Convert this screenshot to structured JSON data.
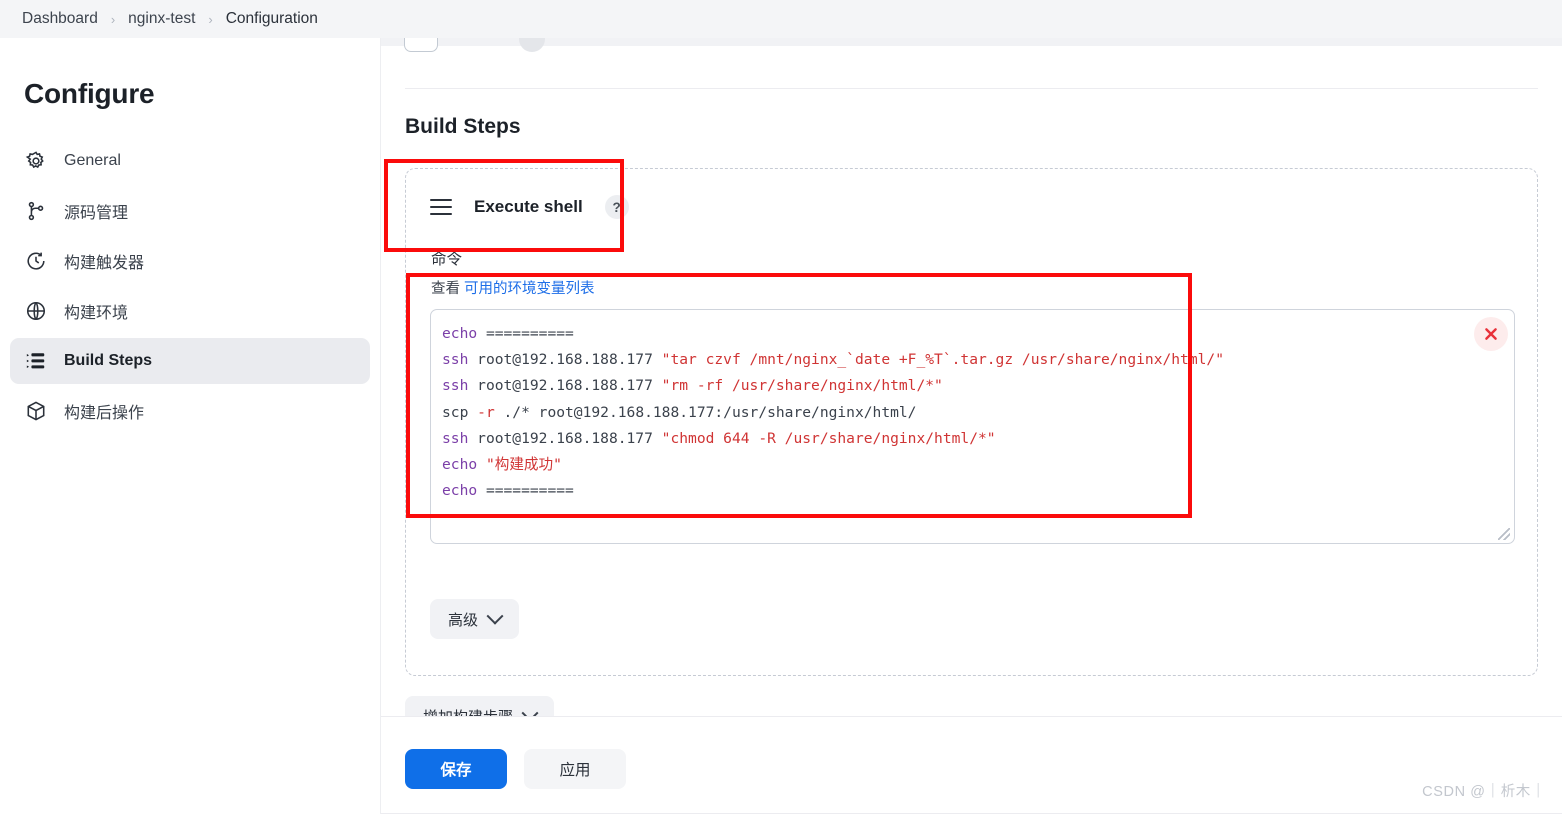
{
  "breadcrumb": {
    "items": [
      "Dashboard",
      "nginx-test",
      "Configuration"
    ],
    "separator": "›"
  },
  "sidebar": {
    "title": "Configure",
    "items": [
      {
        "label": "General",
        "icon": "gear-icon",
        "active": false
      },
      {
        "label": "源码管理",
        "icon": "source-branch-icon",
        "active": false
      },
      {
        "label": "构建触发器",
        "icon": "clock-icon",
        "active": false
      },
      {
        "label": "构建环境",
        "icon": "globe-icon",
        "active": false
      },
      {
        "label": "Build Steps",
        "icon": "list-icon",
        "active": true
      },
      {
        "label": "构建后操作",
        "icon": "package-icon",
        "active": false
      }
    ]
  },
  "main": {
    "section_title": "Build Steps",
    "step": {
      "drag_handle_icon": "hamburger-drag-icon",
      "name": "Execute shell",
      "help_label": "?",
      "delete_icon": "close-icon",
      "field_label": "命令",
      "hint_prefix": "查看 ",
      "hint_link": "可用的环境变量列表",
      "advanced_label": "高级",
      "chevron_icon": "chevron-down-icon"
    },
    "add_step_label": "增加构建步骤",
    "code_lines": [
      [
        {
          "t": "echo ",
          "c": "kw"
        },
        {
          "t": "==========",
          "c": "plain"
        }
      ],
      [
        {
          "t": "ssh ",
          "c": "kw"
        },
        {
          "t": "root@192.168.188.177 ",
          "c": "plain"
        },
        {
          "t": "\"tar czvf /mnt/nginx_`date +F_%T`.tar.gz /usr/share/nginx/html/\"",
          "c": "str"
        }
      ],
      [
        {
          "t": "ssh ",
          "c": "kw"
        },
        {
          "t": "root@192.168.188.177 ",
          "c": "plain"
        },
        {
          "t": "\"rm -rf /usr/share/nginx/html/*\"",
          "c": "str"
        }
      ],
      [
        {
          "t": "scp ",
          "c": "plain"
        },
        {
          "t": "-r",
          "c": "flag"
        },
        {
          "t": " ./* root@192.168.188.177:/usr/share/nginx/html/",
          "c": "plain"
        }
      ],
      [
        {
          "t": "ssh ",
          "c": "kw"
        },
        {
          "t": "root@192.168.188.177 ",
          "c": "plain"
        },
        {
          "t": "\"chmod 644 -R /usr/share/nginx/html/*\"",
          "c": "str"
        }
      ],
      [
        {
          "t": "echo ",
          "c": "kw"
        },
        {
          "t": "\"构建成功\"",
          "c": "str"
        }
      ],
      [
        {
          "t": "echo ",
          "c": "kw"
        },
        {
          "t": "==========",
          "c": "plain"
        }
      ]
    ]
  },
  "footer": {
    "save_label": "保存",
    "apply_label": "应用"
  },
  "watermark": "CSDN @｜析木｜",
  "colors": {
    "accent": "#0f6fe8",
    "link": "#1d6ee8",
    "annotation": "#fb0b0b",
    "code_keyword": "#7b3fa8",
    "code_string": "#d03434",
    "active_nav_bg": "#eaebef"
  }
}
